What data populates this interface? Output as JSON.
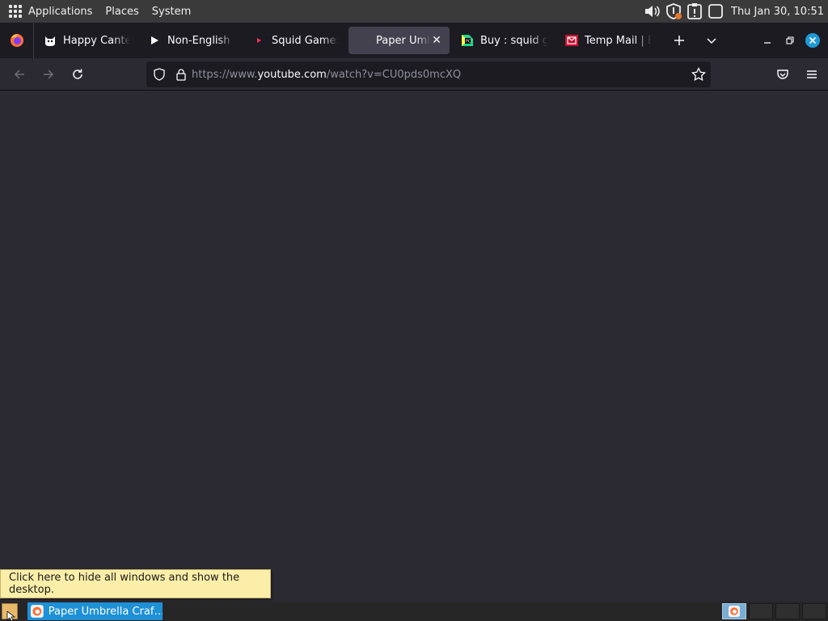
{
  "panel": {
    "menus": [
      "Applications",
      "Places",
      "System"
    ],
    "clock": "Thu Jan 30, 10:51"
  },
  "tabs": [
    {
      "label": "Happy Canteen",
      "icon": "cat-icon",
      "active": false
    },
    {
      "label": "Non-English •",
      "icon": "play-icon",
      "active": false
    },
    {
      "label": "Squid Game: F",
      "icon": "youtube-icon",
      "active": false
    },
    {
      "label": "Paper Umbrella",
      "icon": "blank-page-icon",
      "active": true
    },
    {
      "label": "Buy : squid ga",
      "icon": "pycharm-icon",
      "active": false
    },
    {
      "label": "Temp Mail | Em",
      "icon": "mail-icon",
      "active": false
    }
  ],
  "url": {
    "prefix": "https://www.",
    "host": "youtube.com",
    "path": "/watch?v=CU0pds0mcXQ"
  },
  "tooltip": "Click here to hide all windows and show the desktop.",
  "taskbar": {
    "task_label": "Paper Umbrella Craf…"
  },
  "colors": {
    "accent": "#1e90d6",
    "page_bg": "#2b2a33",
    "tabbar_bg": "#1c1b22",
    "tooltip_bg": "#fbeea8"
  }
}
